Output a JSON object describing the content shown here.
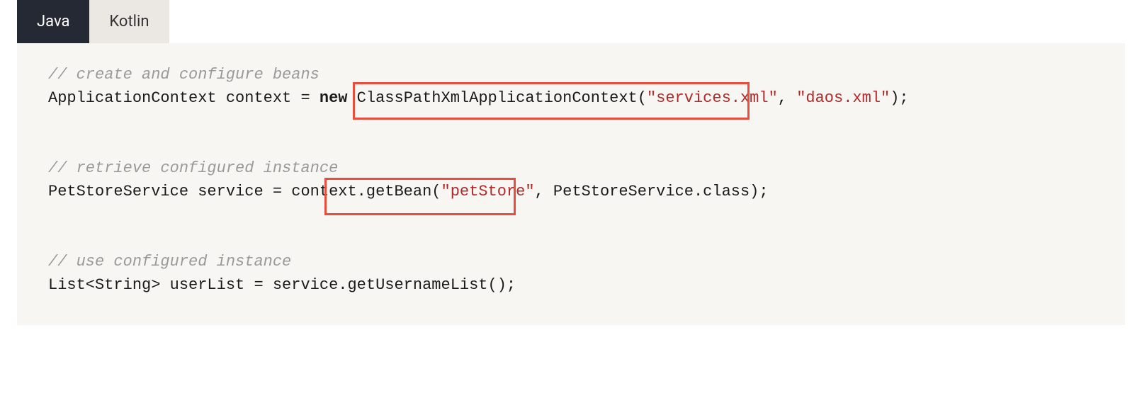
{
  "tabs": {
    "java": "Java",
    "kotlin": "Kotlin"
  },
  "code": {
    "line1_comment": "// create and configure beans",
    "line2": {
      "p1": "ApplicationContext context = ",
      "kw": "new",
      "p2": " ClassPathXmlApplicationContext(",
      "s1": "\"services.xml\"",
      "p3": ", ",
      "s2": "\"daos.xml\"",
      "p4": ");"
    },
    "line4_comment": "// retrieve configured instance",
    "line5": {
      "p1": "PetStoreService service = context.getBean(",
      "s1": "\"petStore\"",
      "p2": ", PetStoreService.class);"
    },
    "line7_comment": "// use configured instance",
    "line8": {
      "p1": "List<String> userList = service.getUsernameList();"
    }
  }
}
